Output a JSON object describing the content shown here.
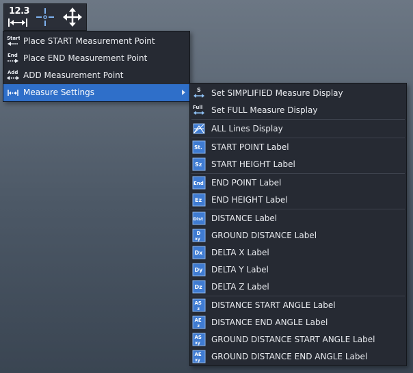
{
  "toolbar": {
    "measure_value": "12.3"
  },
  "main_menu": [
    {
      "label": "Place START Measurement Point",
      "icon": "start-icon",
      "icon_text": "Start"
    },
    {
      "label": "Place END Measurement Point",
      "icon": "end-icon",
      "icon_text": "End"
    },
    {
      "label": "ADD Measurement Point",
      "icon": "add-icon",
      "icon_text": "Add"
    },
    {
      "label": "Measure Settings",
      "icon": "measure-settings-icon",
      "active": true
    }
  ],
  "sub_menu": [
    {
      "label": "Set SIMPLIFIED Measure Display",
      "icon": "simplified-icon",
      "icon_text": "S"
    },
    {
      "label": "Set FULL Measure Display",
      "icon": "full-icon",
      "icon_text": "Full"
    },
    {
      "label": "ALL Lines Display",
      "icon": "all-lines-icon"
    },
    {
      "label": "START POINT Label",
      "icon": "start-point-label-icon",
      "icon_text": "St."
    },
    {
      "label": "START HEIGHT Label",
      "icon": "start-height-label-icon",
      "icon_text": "Sz"
    },
    {
      "label": "END POINT Label",
      "icon": "end-point-label-icon",
      "icon_text": "End"
    },
    {
      "label": "END HEIGHT Label",
      "icon": "end-height-label-icon",
      "icon_text": "Ez"
    },
    {
      "label": "DISTANCE Label",
      "icon": "distance-label-icon",
      "icon_text": "Dist"
    },
    {
      "label": "GROUND DISTANCE Label",
      "icon": "ground-distance-label-icon",
      "icon_text": "D"
    },
    {
      "label": "DELTA X Label",
      "icon": "delta-x-label-icon",
      "icon_text": "Dx"
    },
    {
      "label": "DELTA Y Label",
      "icon": "delta-y-label-icon",
      "icon_text": "Dy"
    },
    {
      "label": "DELTA Z Label",
      "icon": "delta-z-label-icon",
      "icon_text": "Dz"
    },
    {
      "label": "DISTANCE START ANGLE Label",
      "icon": "distance-start-angle-label-icon",
      "icon_text": "AS"
    },
    {
      "label": "DISTANCE END ANGLE Label",
      "icon": "distance-end-angle-label-icon",
      "icon_text": "AE"
    },
    {
      "label": "GROUND DISTANCE START ANGLE Label",
      "icon": "ground-distance-start-angle-label-icon",
      "icon_text": "AS"
    },
    {
      "label": "GROUND DISTANCE END ANGLE Label",
      "icon": "ground-distance-end-angle-label-icon",
      "icon_text": "AE"
    }
  ]
}
